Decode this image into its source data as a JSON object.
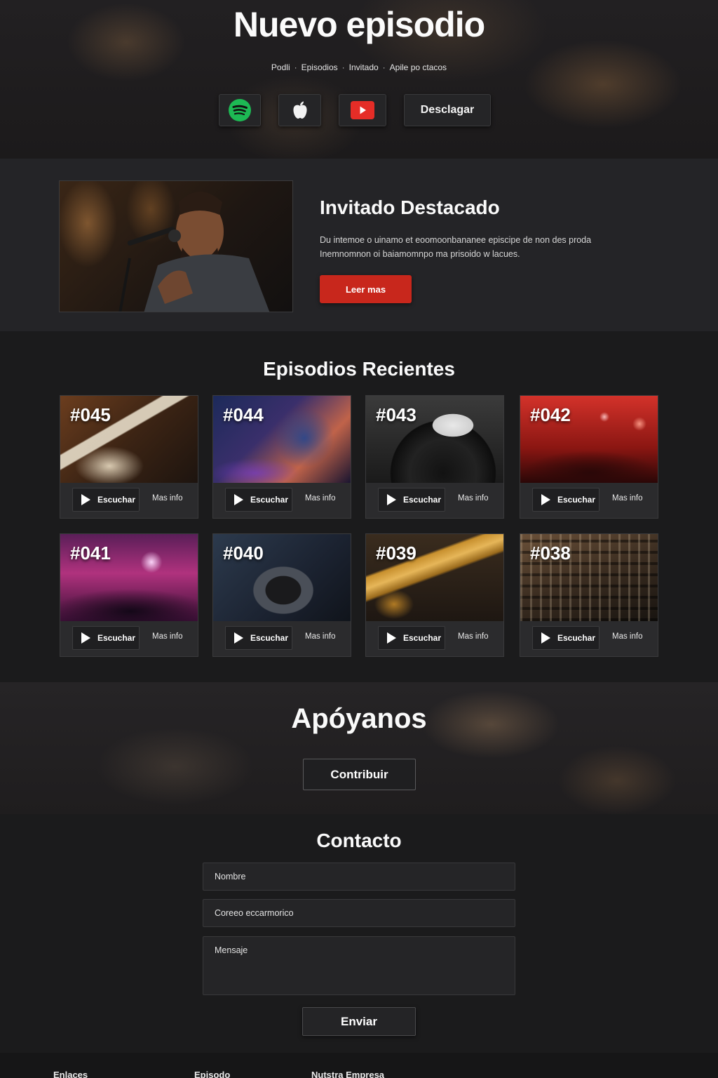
{
  "hero": {
    "title": "Nuevo episodio",
    "nav": [
      "Podli",
      "Episodios",
      "Invitado",
      "Apile po ctacos"
    ],
    "platforms": {
      "spotify": "spotify-icon",
      "apple": "apple-icon",
      "youtube": "youtube-icon"
    },
    "download_label": "Desclagar"
  },
  "featured": {
    "title": "Invitado Destacado",
    "text": "Du intemoe o uinamo et eoomoonbananee episcipe de non des proda Inemnomnon oi baiamomnpo ma prisoido w lacues.",
    "button": "Leer mas"
  },
  "episodes": {
    "title": "Episodios Recientes",
    "listen_label": "Escuchar",
    "more_label": "Mas info",
    "items": [
      {
        "number": "#045"
      },
      {
        "number": "#044"
      },
      {
        "number": "#043"
      },
      {
        "number": "#042"
      },
      {
        "number": "#041"
      },
      {
        "number": "#040"
      },
      {
        "number": "#039"
      },
      {
        "number": "#038"
      }
    ]
  },
  "support": {
    "title": "Apóyanos",
    "button": "Contribuir"
  },
  "contact": {
    "title": "Contacto",
    "name_placeholder": "Nombre",
    "email_placeholder": "Coreeo eccarmorico",
    "message_placeholder": "Mensaje",
    "submit": "Enviar"
  },
  "footer": {
    "columns": [
      "Enlaces",
      "Episodo",
      "Nutstra Empresa"
    ]
  },
  "colors": {
    "accent_red": "#c8271c",
    "spotify_green": "#1db954",
    "youtube_red": "#e52d27",
    "background": "#1b1b1d"
  }
}
